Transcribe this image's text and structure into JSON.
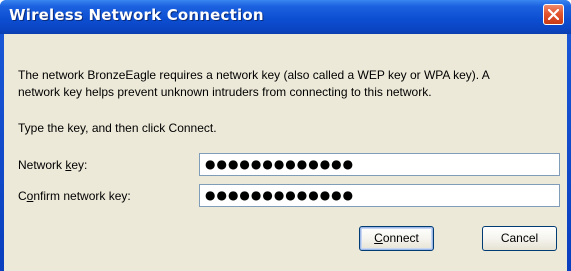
{
  "window": {
    "title": "Wireless Network Connection"
  },
  "message": {
    "line1": "The network BronzeEagle requires a network key (also called a WEP key or WPA key). A",
    "line2": "network key helps prevent unknown intruders from connecting to this network."
  },
  "instruction": "Type the key, and then click Connect.",
  "fields": {
    "network_key": {
      "label_prefix": "Network ",
      "label_accel": "k",
      "label_suffix": "ey:",
      "value": "●●●●●●●●●●●●●"
    },
    "confirm_key": {
      "label_prefix": "C",
      "label_accel": "o",
      "label_suffix": "nfirm network key:",
      "value": "●●●●●●●●●●●●●"
    }
  },
  "buttons": {
    "connect_accel": "C",
    "connect_rest": "onnect",
    "cancel": "Cancel"
  },
  "icons": {
    "close": "close-icon"
  },
  "colors": {
    "titlebar": "#0d4fd2",
    "close_button": "#e2552f",
    "dialog_background": "#ece9d8"
  }
}
